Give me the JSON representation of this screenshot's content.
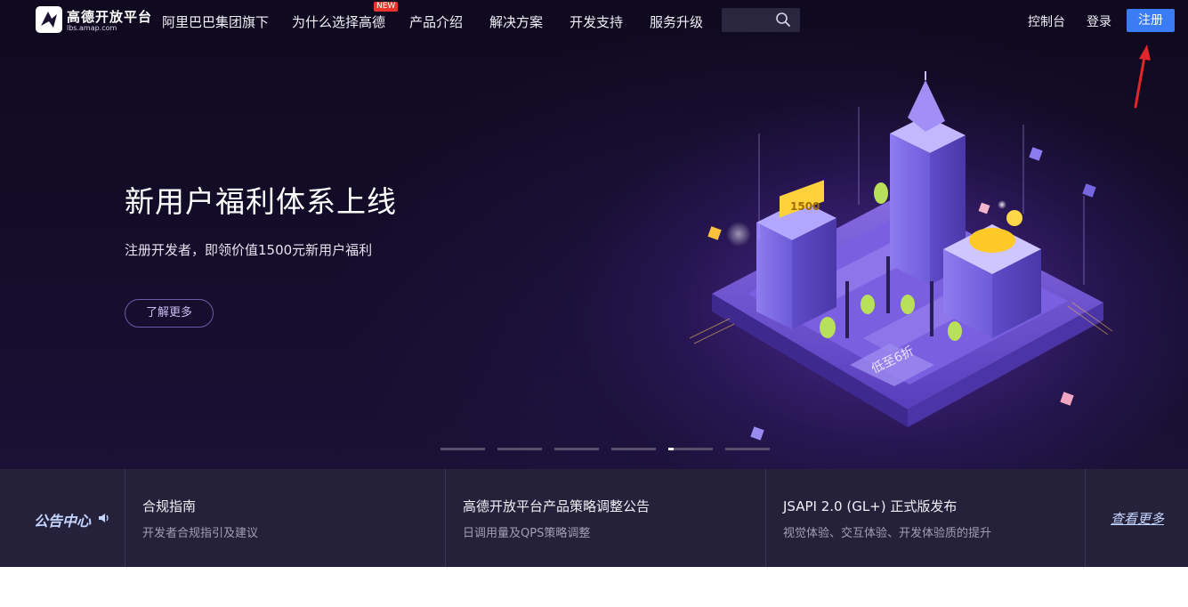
{
  "brand": {
    "name": "高德开放平台",
    "domain": "lbs.amap.com"
  },
  "nav": {
    "items": [
      {
        "label": "阿里巴巴集团旗下"
      },
      {
        "label": "为什么选择高德",
        "badge": "NEW"
      },
      {
        "label": "产品介绍"
      },
      {
        "label": "解决方案"
      },
      {
        "label": "开发支持"
      },
      {
        "label": "服务升级"
      }
    ],
    "search": {
      "placeholder": "",
      "icon": "search-icon"
    },
    "console": "控制台",
    "login": "登录",
    "register": "注册"
  },
  "hero": {
    "title": "新用户福利体系上线",
    "subtitle": "注册开发者，即领价值1500元新用户福利",
    "cta": "了解更多",
    "illustration": {
      "tag_value": "1500",
      "sign_text": "低至6折"
    },
    "slides": {
      "count": 6,
      "active_index": 4
    }
  },
  "notices": {
    "label": "公告中心",
    "items": [
      {
        "title": "合规指南",
        "desc": "开发者合规指引及建议"
      },
      {
        "title": "高德开放平台产品策略调整公告",
        "desc": "日调用量及QPS策略调整"
      },
      {
        "title": "JSAPI 2.0 (GL+) 正式版发布",
        "desc": "视觉体验、交互体验、开发体验质的提升"
      }
    ],
    "more": "查看更多"
  },
  "colors": {
    "accent": "#3a7bf6",
    "badge": "#e8342d",
    "hero_bg": "#140d2a",
    "notice_bg": "#26213a",
    "annotation_arrow": "#e3262b"
  }
}
